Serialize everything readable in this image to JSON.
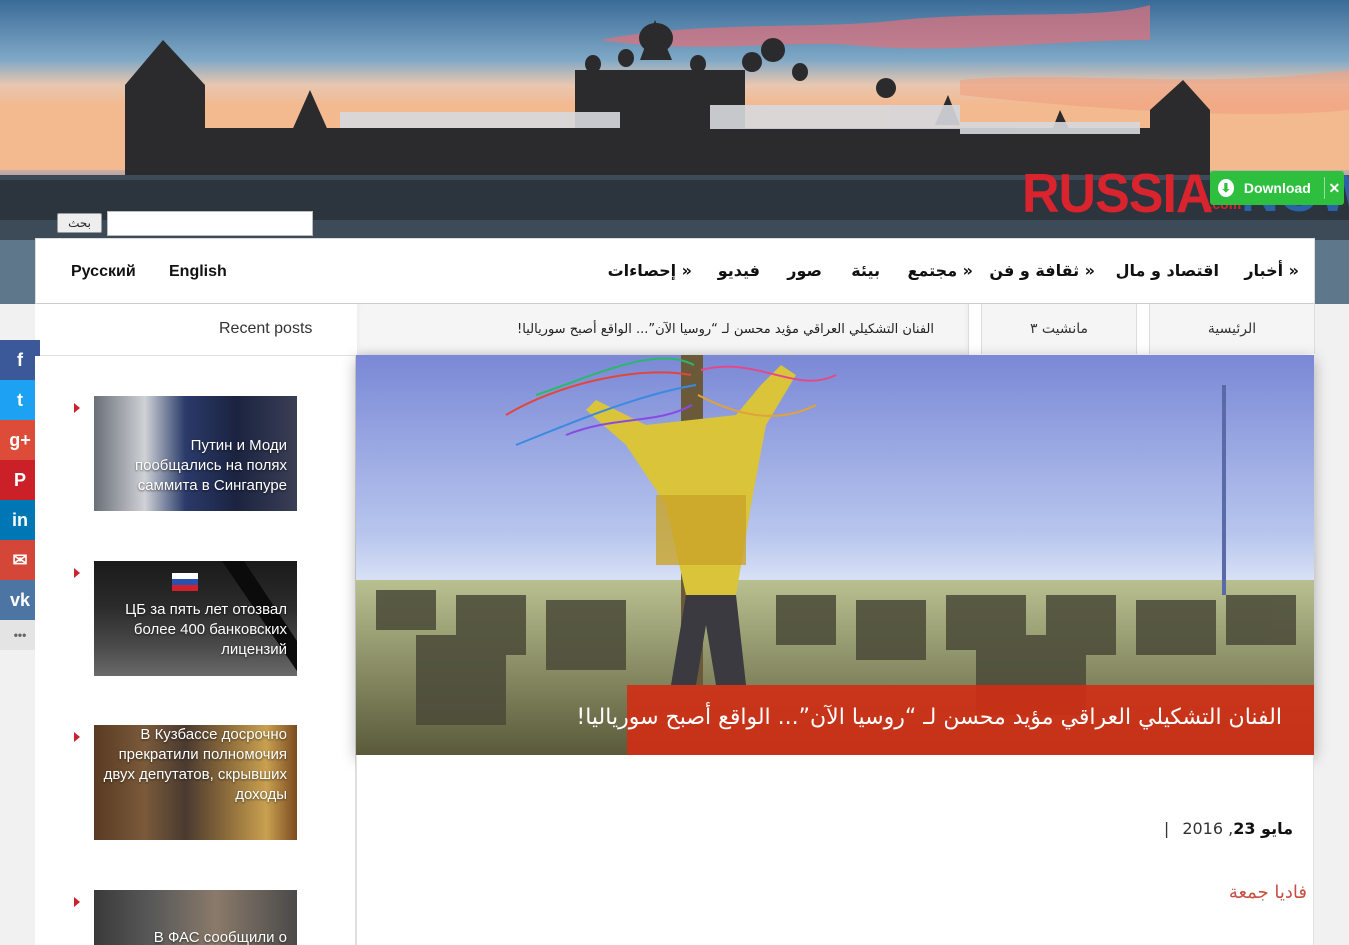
{
  "header": {
    "logo": {
      "main": "RUSSIA",
      "com": ".com",
      "now": "NOW"
    },
    "download": {
      "label": "Download",
      "close": "✕"
    },
    "search": {
      "button_label": "بحث",
      "placeholder": ""
    }
  },
  "nav": {
    "items": [
      "أخبار »",
      "اقتصاد و مال",
      "ثقافة و فن »",
      "مجتمع »",
      "بيئة",
      "صور",
      "فيديو",
      "إحصاءات »"
    ],
    "languages": [
      "Русский",
      "English"
    ]
  },
  "subbar": {
    "recent_title": "Recent posts",
    "tabs": [
      "الرئيسية",
      "مانشيت ٣"
    ],
    "ticker": "الفنان التشكيلي العراقي مؤيد محسن لـ “روسيا الآن”... الواقع أصبح سورياليا!"
  },
  "share": {
    "buttons": [
      {
        "icon": "facebook-icon",
        "glyph": "f",
        "color": "#3b5998"
      },
      {
        "icon": "twitter-icon",
        "glyph": "t",
        "color": "#1da1f2"
      },
      {
        "icon": "google-plus-icon",
        "glyph": "g+",
        "color": "#dd4b39"
      },
      {
        "icon": "pinterest-icon",
        "glyph": "P",
        "color": "#cb2027"
      },
      {
        "icon": "linkedin-icon",
        "glyph": "in",
        "color": "#0077b5"
      },
      {
        "icon": "email-icon",
        "glyph": "✉",
        "color": "#d44638"
      },
      {
        "icon": "vk-icon",
        "glyph": "vk",
        "color": "#4c75a3"
      },
      {
        "icon": "more-icon",
        "glyph": "•••",
        "color": "#e4e4e4"
      }
    ]
  },
  "recent_posts": [
    "Путин и Моди пообщались на полях саммита в Сингапуре",
    "ЦБ за пять лет отозвал более 400 банковских лицензий",
    "В Кузбассе досрочно прекратили полномочия двух депутатов, скрывших доходы",
    "В ФАС сообщили о"
  ],
  "feature": {
    "caption": "الفنان التشكيلي العراقي مؤيد محسن لـ “روسيا الآن”... الواقع أصبح سورياليا!"
  },
  "article": {
    "date_day": "مايو 23",
    "date_year": ", 2016",
    "date_sep": "|",
    "author": "فاديا جمعة"
  }
}
